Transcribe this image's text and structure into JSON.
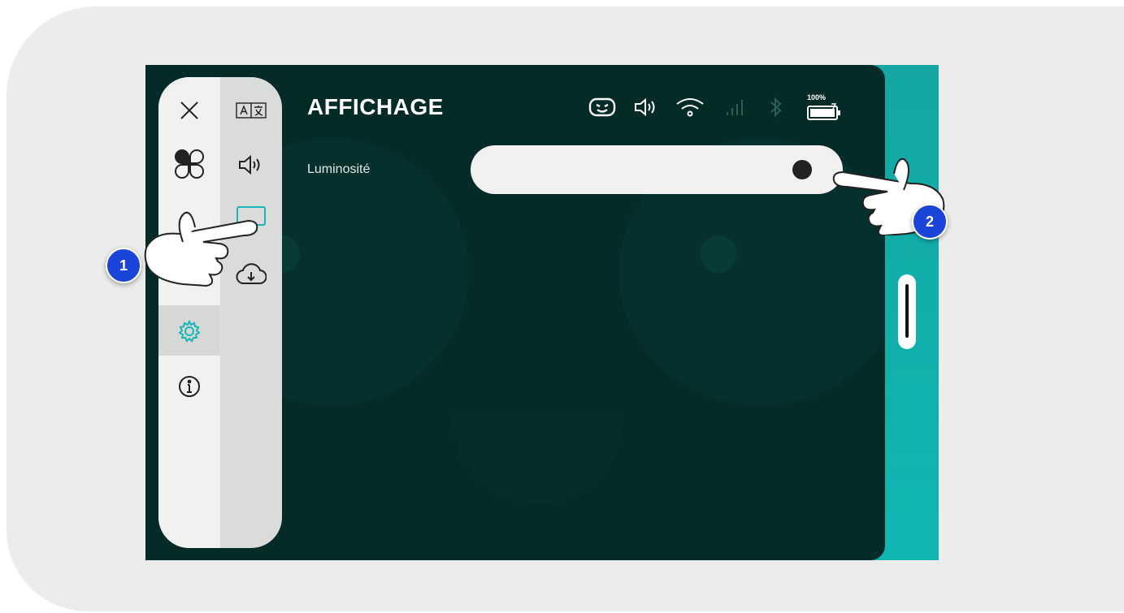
{
  "header": {
    "title": "AFFICHAGE"
  },
  "settings": {
    "brightness_label": "Luminosité",
    "brightness_level": 0.95
  },
  "status": {
    "battery_text": "100%",
    "icons": [
      "robot-face-icon",
      "volume-icon",
      "wifi-icon",
      "cellular-signal-icon",
      "bluetooth-icon",
      "battery-charging-icon"
    ]
  },
  "sidebar": {
    "main_items": [
      "close-icon",
      "apps-icon",
      "hidden-item",
      "settings-icon",
      "info-icon"
    ],
    "sub_items": [
      "language-icon",
      "sound-icon",
      "display-icon",
      "update-icon"
    ],
    "active_main": "settings-icon",
    "active_sub": "display-icon"
  },
  "annotations": {
    "marker_1": "1",
    "marker_2": "2"
  },
  "colors": {
    "accent": "#18b6b6",
    "marker": "#1a45d8",
    "panel_bg": "#042b28",
    "page_bg": "#ececec"
  }
}
